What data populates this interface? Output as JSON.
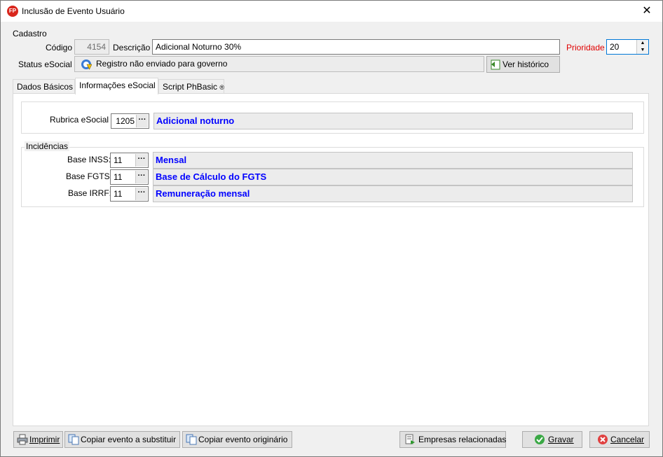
{
  "window": {
    "title": "Inclusão de Evento Usuário",
    "close_label": "✕",
    "app_icon_text": "FP"
  },
  "cadastro": {
    "group_label": "Cadastro",
    "codigo_label": "Código",
    "codigo_value": "4154",
    "descricao_label": "Descrição",
    "descricao_value": "Adicional Noturno 30%",
    "prioridade_label": "Prioridade",
    "prioridade_value": "20",
    "status_label": "Status eSocial",
    "status_value": "Registro não enviado para governo",
    "historico_button": "Ver histórico"
  },
  "tabs": [
    {
      "label": "Dados Básicos"
    },
    {
      "label": "Informações eSocial"
    },
    {
      "label": "Script PhBasic"
    }
  ],
  "esocial": {
    "rubrica_label": "Rubrica eSocial",
    "rubrica_code": "1205",
    "rubrica_desc": "Adicional noturno",
    "incidencias_label": "Incidências",
    "rows": [
      {
        "label": "Base INSS:",
        "code": "11",
        "desc": "Mensal"
      },
      {
        "label": "Base FGTS:",
        "code": "11",
        "desc": "Base de Cálculo do FGTS"
      },
      {
        "label": "Base IRRF:",
        "code": "11",
        "desc": "Remuneração mensal"
      }
    ],
    "ellipsis": "···"
  },
  "footer": {
    "imprimir": "Imprimir",
    "copiar_substituir": "Copiar evento a substituir",
    "copiar_originario": "Copiar evento originário",
    "empresas": "Empresas relacionadas",
    "gravar": "Gravar",
    "cancelar": "Cancelar"
  },
  "colors": {
    "accent_blue": "#0000ff",
    "prioridade_red": "#e00000",
    "focus_border": "#0078d7"
  }
}
